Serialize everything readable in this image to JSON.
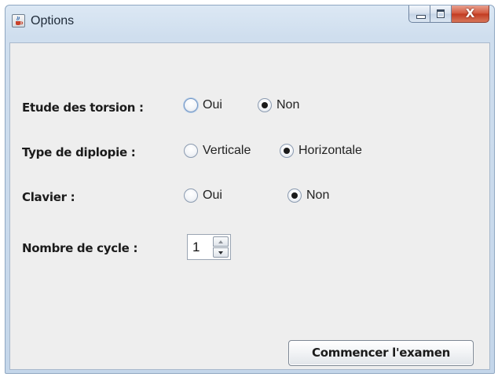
{
  "window": {
    "title": "Options",
    "icon": "java-cup-icon",
    "controls": [
      "minimize-icon",
      "maximize-icon",
      "close-icon"
    ],
    "close_glyph": "X",
    "accent_color": "#c23a20"
  },
  "form": {
    "torsion": {
      "label": "Etude des torsion :",
      "options": [
        {
          "label": "Oui",
          "selected": false
        },
        {
          "label": "Non",
          "selected": true
        }
      ]
    },
    "diplopie": {
      "label": "Type de diplopie :",
      "options": [
        {
          "label": "Verticale",
          "selected": false
        },
        {
          "label": "Horizontale",
          "selected": true
        }
      ]
    },
    "clavier": {
      "label": "Clavier :",
      "options": [
        {
          "label": "Oui",
          "selected": false
        },
        {
          "label": "Non",
          "selected": true
        }
      ]
    },
    "cycles": {
      "label": "Nombre de cycle :",
      "value": "1"
    }
  },
  "actions": {
    "start_label": "Commencer l'examen"
  }
}
